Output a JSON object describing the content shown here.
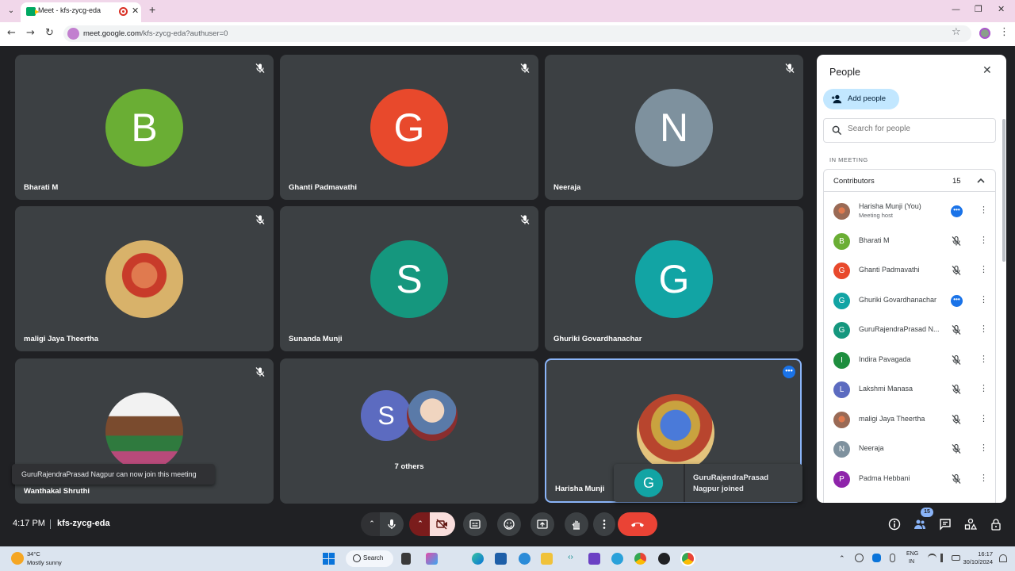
{
  "browser": {
    "tab_title": "Meet - kfs-zycg-eda",
    "url_host": "meet.google.com",
    "url_path": "/kfs-zycg-eda?authuser=0"
  },
  "tiles": [
    {
      "name": "Bharati M",
      "initial": "B",
      "color": "#6aae34",
      "muted": true
    },
    {
      "name": "Ghanti Padmavathi",
      "initial": "G",
      "color": "#e8492c",
      "muted": true
    },
    {
      "name": "Neeraja",
      "initial": "N",
      "color": "#7e919e",
      "muted": true
    },
    {
      "name": "maligi Jaya Theertha",
      "initial": "",
      "color": "",
      "muted": true
    },
    {
      "name": "Sunanda Munji",
      "initial": "S",
      "color": "#15977e",
      "muted": true
    },
    {
      "name": "Ghuriki Govardhanachar",
      "initial": "G",
      "color": "#12a4a4",
      "muted": false
    },
    {
      "name": "Wanthakal Shruthi",
      "initial": "",
      "color": "",
      "muted": true
    },
    {
      "name": "7 others",
      "initial": "S",
      "color": "#5c6bc0",
      "muted": false
    },
    {
      "name": "Harisha Munji",
      "initial": "",
      "color": "",
      "muted": false
    }
  ],
  "toast": "GuruRajendraPrasad Nagpur can now join this meeting",
  "join_card": {
    "initial": "G",
    "text": "GuruRajendraPrasad Nagpur joined"
  },
  "panel": {
    "title": "People",
    "add_people": "Add people",
    "search_placeholder": "Search for people",
    "section": "IN MEETING",
    "group_title": "Contributors",
    "group_count": "15",
    "people": [
      {
        "name": "Harisha Munji (You)",
        "sub": "Meeting host",
        "initial": "",
        "color": "",
        "status": "more"
      },
      {
        "name": "Bharati M",
        "sub": "",
        "initial": "B",
        "color": "#6aae34",
        "status": "muted"
      },
      {
        "name": "Ghanti Padmavathi",
        "sub": "",
        "initial": "G",
        "color": "#e8492c",
        "status": "muted"
      },
      {
        "name": "Ghuriki Govardhanachar",
        "sub": "",
        "initial": "G",
        "color": "#12a4a4",
        "status": "more"
      },
      {
        "name": "GuruRajendraPrasad N...",
        "sub": "",
        "initial": "G",
        "color": "#15977e",
        "status": "muted"
      },
      {
        "name": "Indira Pavagada",
        "sub": "",
        "initial": "I",
        "color": "#1e8e3e",
        "status": "muted"
      },
      {
        "name": "Lakshmi Manasa",
        "sub": "",
        "initial": "L",
        "color": "#5c6bc0",
        "status": "muted"
      },
      {
        "name": "maligi Jaya Theertha",
        "sub": "",
        "initial": "",
        "color": "",
        "status": "muted"
      },
      {
        "name": "Neeraja",
        "sub": "",
        "initial": "N",
        "color": "#7e919e",
        "status": "muted"
      },
      {
        "name": "Padma Hebbani",
        "sub": "",
        "initial": "P",
        "color": "#8e24aa",
        "status": "muted"
      }
    ]
  },
  "bottom": {
    "time": "4:17 PM",
    "meeting_code": "kfs-zycg-eda",
    "people_badge": "15"
  },
  "taskbar": {
    "temp": "34°C",
    "weather": "Mostly sunny",
    "search": "Search",
    "lang1": "ENG",
    "lang2": "IN",
    "time": "16:17",
    "date": "30/10/2024"
  }
}
